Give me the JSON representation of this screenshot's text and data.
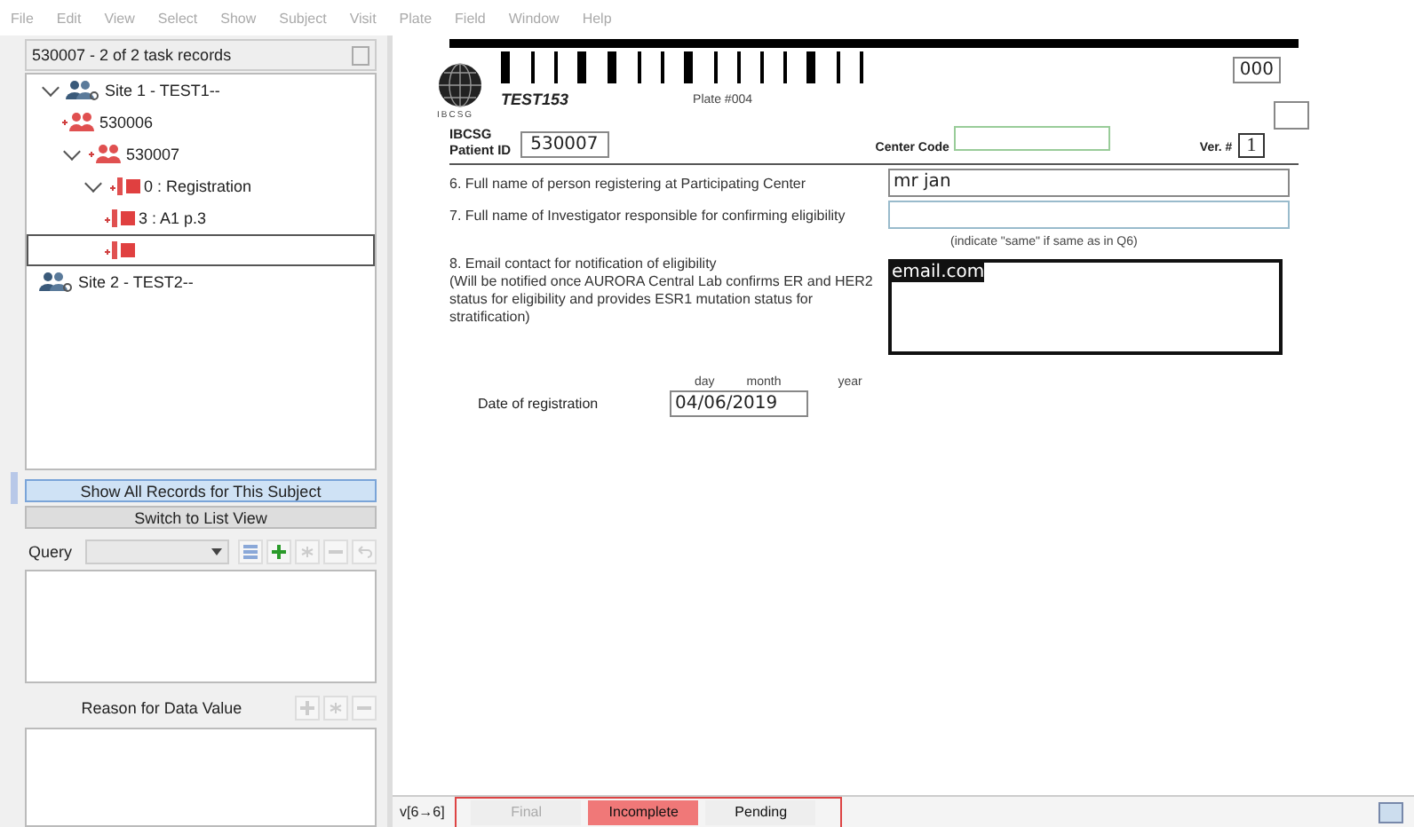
{
  "menu": [
    "File",
    "Edit",
    "View",
    "Select",
    "Show",
    "Subject",
    "Visit",
    "Plate",
    "Field",
    "Window",
    "Help"
  ],
  "records_header": "530007 - 2 of 2 task records",
  "tree": [
    {
      "label": "Site 1 - TEST1--",
      "kind": "site",
      "selected": false,
      "expanded": true,
      "children": [
        {
          "label": "530006",
          "kind": "subject",
          "selected": false
        },
        {
          "label": "530007",
          "kind": "subject",
          "selected": false,
          "expanded": true,
          "children": [
            {
              "label": "0 : Registration",
              "kind": "visit",
              "selected": false,
              "expanded": true,
              "children": [
                {
                  "label": "3 : A1 p.3",
                  "kind": "plate",
                  "selected": false
                },
                {
                  "kind": "plate",
                  "selected": true
                }
              ]
            }
          ]
        }
      ]
    },
    {
      "label": "Site 2 - TEST2--",
      "kind": "site",
      "selected": false
    }
  ],
  "panel_buttons": [
    {
      "label": "Show All Records for This Subject",
      "selected": true
    },
    {
      "label": "Switch to List View",
      "selected": false
    }
  ],
  "query_label": "Query",
  "reason_label": "Reason for Data Value",
  "form": {
    "study": "TEST153",
    "plate": "Plate #004",
    "page_code": "000",
    "org": "IBCSG",
    "patient_id_label": "IBCSG\nPatient ID",
    "patient_id": "530007",
    "center_code_label": "Center Code",
    "version_label": "Ver. #",
    "version": "1",
    "q6": "6.  Full name of person registering at Participating Center",
    "q6_value": "mr jan",
    "q7": "7.  Full name of Investigator responsible for confirming eligibility",
    "q7_hint": "(indicate \"same\" if same as in Q6)",
    "q8": "8. Email contact for notification of eligibility\n(Will be notified once AURORA Central Lab confirms ER and HER2 status for eligibility and provides ESR1 mutation status for stratification)",
    "q8_value": "email.com",
    "date_parts": [
      "day",
      "month",
      "year"
    ],
    "date_label": "Date of registration",
    "date_value": "04/06/2019"
  },
  "version_flow": "v[6→6]",
  "statuses": [
    {
      "label": "Final",
      "selected": false,
      "disabled": true
    },
    {
      "label": "Incomplete",
      "selected": true,
      "disabled": false
    },
    {
      "label": "Pending",
      "selected": false,
      "disabled": false
    }
  ]
}
